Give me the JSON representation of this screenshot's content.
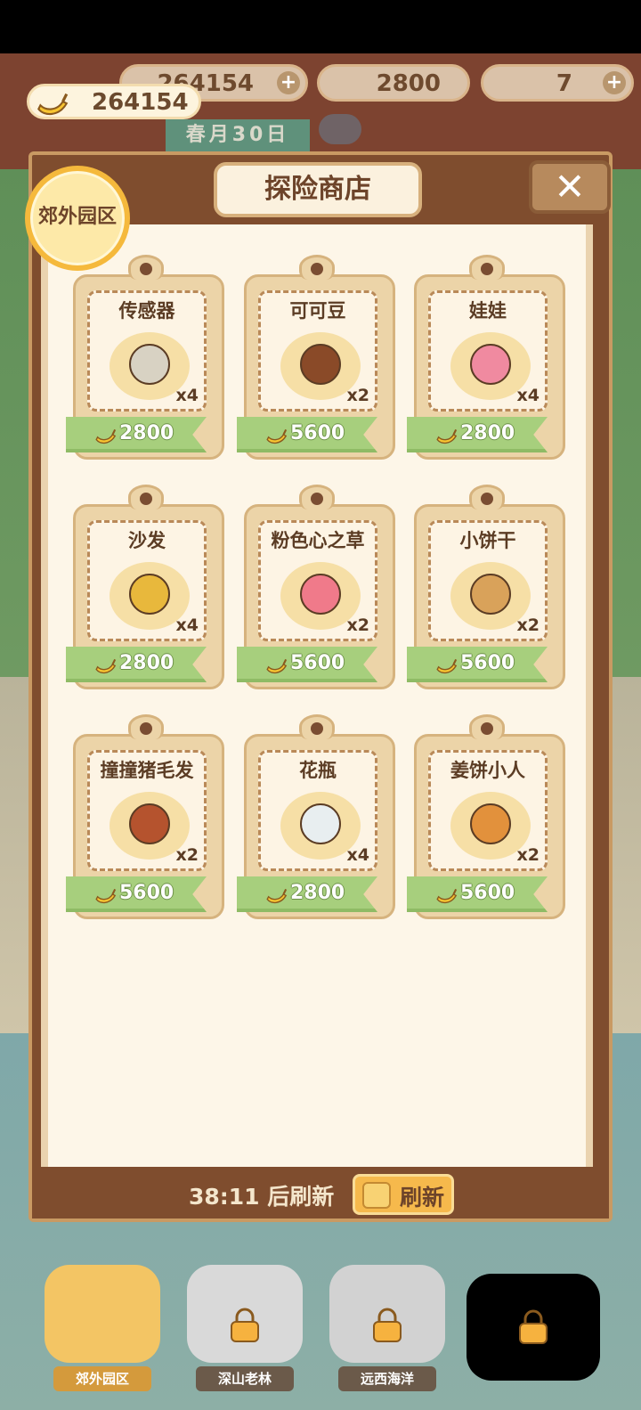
{
  "top_bar": {
    "bananas": "264154",
    "fire": "2800",
    "fish": "7",
    "date": "春月30日"
  },
  "header": {
    "coin_display": "264154",
    "area_name": "郊外园区",
    "title": "探险商店",
    "close_icon": "close-icon"
  },
  "items": [
    {
      "name": "传感器",
      "qty": "x4",
      "price": "2800",
      "icon": "sensor-icon"
    },
    {
      "name": "可可豆",
      "qty": "x2",
      "price": "5600",
      "icon": "cocoa-bean-icon"
    },
    {
      "name": "娃娃",
      "qty": "x4",
      "price": "2800",
      "icon": "doll-icon"
    },
    {
      "name": "沙发",
      "qty": "x4",
      "price": "2800",
      "icon": "sofa-icon"
    },
    {
      "name": "粉色心之草",
      "qty": "x2",
      "price": "5600",
      "icon": "pink-heart-grass-icon"
    },
    {
      "name": "小饼干",
      "qty": "x2",
      "price": "5600",
      "icon": "cookie-icon"
    },
    {
      "name": "撞撞猪毛发",
      "qty": "x2",
      "price": "5600",
      "icon": "pig-fur-icon"
    },
    {
      "name": "花瓶",
      "qty": "x4",
      "price": "2800",
      "icon": "vase-icon"
    },
    {
      "name": "姜饼小人",
      "qty": "x2",
      "price": "5600",
      "icon": "gingerbread-man-icon"
    }
  ],
  "footer": {
    "refresh_timer": "38:11 后刷新",
    "refresh_button": "刷新"
  },
  "areas": [
    {
      "label": "郊外园区",
      "locked": false
    },
    {
      "label": "深山老林",
      "locked": true
    },
    {
      "label": "远西海洋",
      "locked": true
    },
    {
      "label": "",
      "locked": true
    }
  ],
  "colors": {
    "panel_brown": "#7f4d2e",
    "ribbon_green": "#a7cf7d",
    "badge_yellow": "#f5b93c",
    "cream": "#fdf6e8"
  }
}
